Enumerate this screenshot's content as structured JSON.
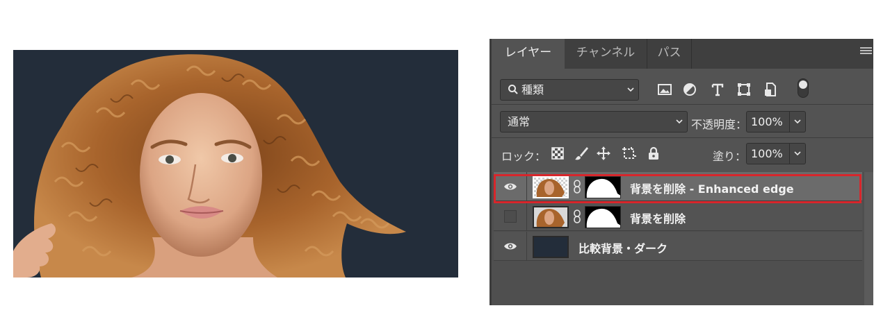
{
  "tabs": [
    {
      "label": "レイヤー",
      "active": true
    },
    {
      "label": "チャンネル",
      "active": false
    },
    {
      "label": "パス",
      "active": false
    }
  ],
  "filter": {
    "kind_label": "種類",
    "icons": [
      "image-filter-icon",
      "adjustment-filter-icon",
      "type-filter-icon",
      "shape-filter-icon",
      "smart-object-filter-icon"
    ]
  },
  "blend": {
    "mode": "通常",
    "opacity_label": "不透明度：",
    "opacity_value": "100%"
  },
  "lock": {
    "label": "ロック：",
    "fill_label": "塗り：",
    "fill_value": "100%"
  },
  "layers": [
    {
      "name": "背景を削除 - Enhanced edge",
      "visible": true,
      "selected": true,
      "has_mask": true
    },
    {
      "name": "背景を削除",
      "visible": false,
      "selected": false,
      "has_mask": true
    },
    {
      "name": "比較背景・ダーク",
      "visible": true,
      "selected": false,
      "has_mask": false
    }
  ],
  "colors": {
    "backdrop": "#232d3a",
    "hair": "#a8642c",
    "highlight": "#d8262b",
    "panel": "#535353"
  }
}
